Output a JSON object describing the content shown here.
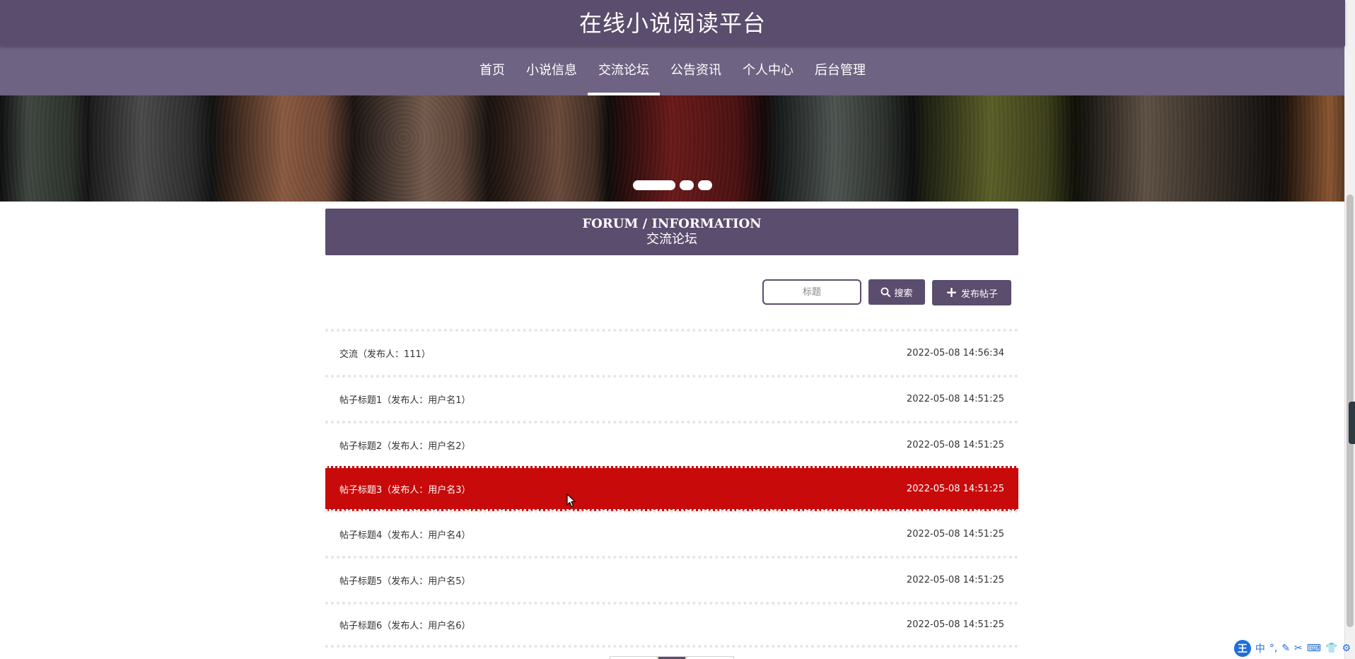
{
  "header": {
    "site_title": "在线小说阅读平台"
  },
  "nav": {
    "items": [
      {
        "label": "首页"
      },
      {
        "label": "小说信息"
      },
      {
        "label": "交流论坛"
      },
      {
        "label": "公告资讯"
      },
      {
        "label": "个人中心"
      },
      {
        "label": "后台管理"
      }
    ],
    "active_index": 2
  },
  "banner": {
    "slide_count": 3,
    "active_slide": 1
  },
  "section": {
    "title_en": "FORUM / INFORMATION",
    "title_cn": "交流论坛"
  },
  "search": {
    "placeholder": "标题",
    "value": "",
    "search_label": "搜索",
    "publish_label": "发布帖子"
  },
  "posts": [
    {
      "title": "交流（发布人：111）",
      "time": "2022-05-08 14:56:34"
    },
    {
      "title": "帖子标题1（发布人：用户名1）",
      "time": "2022-05-08 14:51:25"
    },
    {
      "title": "帖子标题2（发布人：用户名2）",
      "time": "2022-05-08 14:51:25"
    },
    {
      "title": "帖子标题3（发布人：用户名3）",
      "time": "2022-05-08 14:51:25"
    },
    {
      "title": "帖子标题4（发布人：用户名4）",
      "time": "2022-05-08 14:51:25"
    },
    {
      "title": "帖子标题5（发布人：用户名5）",
      "time": "2022-05-08 14:51:25"
    },
    {
      "title": "帖子标题6（发布人：用户名6）",
      "time": "2022-05-08 14:51:25"
    }
  ],
  "hovered_post_index": 3,
  "ime": {
    "logo": "王",
    "mode": "中"
  },
  "colors": {
    "primary": "#5b4d6d",
    "nav_bg": "#6e6382",
    "hover_row": "#c90a0a"
  },
  "icons": {
    "search": "magnifier-icon",
    "publish": "plus-icon"
  }
}
